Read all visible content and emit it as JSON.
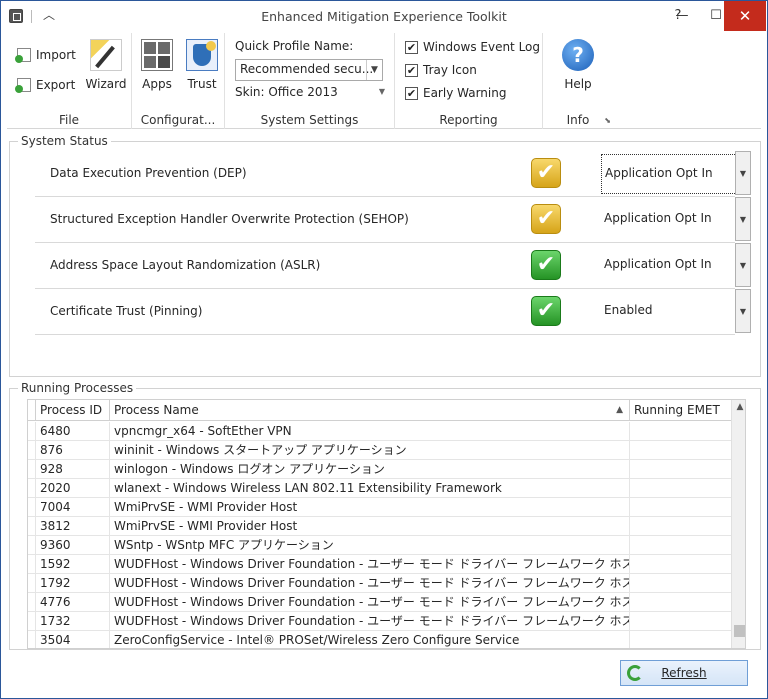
{
  "window": {
    "title": "Enhanced Mitigation Experience Toolkit"
  },
  "ribbon": {
    "file": {
      "label": "File",
      "import": "Import",
      "export": "Export",
      "wizard": "Wizard"
    },
    "configuration": {
      "label": "Configurat...",
      "apps": "Apps",
      "trust": "Trust"
    },
    "system_settings": {
      "label": "System Settings",
      "quick_profile_label": "Quick Profile Name:",
      "quick_profile_value": "Recommended secu...",
      "skin": "Skin: Office 2013"
    },
    "reporting": {
      "label": "Reporting",
      "windows_event_log": "Windows Event Log",
      "tray_icon": "Tray Icon",
      "early_warning": "Early Warning"
    },
    "info": {
      "label": "Info",
      "help": "Help"
    }
  },
  "system_status": {
    "title": "System Status",
    "rows": [
      {
        "label": "Data Execution Prevention (DEP)",
        "value": "Application Opt In",
        "status": "yellow"
      },
      {
        "label": "Structured Exception Handler Overwrite Protection (SEHOP)",
        "value": "Application Opt In",
        "status": "yellow"
      },
      {
        "label": "Address Space Layout Randomization (ASLR)",
        "value": "Application Opt In",
        "status": "green"
      },
      {
        "label": "Certificate Trust (Pinning)",
        "value": "Enabled",
        "status": "green"
      }
    ]
  },
  "running_processes": {
    "title": "Running Processes",
    "columns": [
      "Process ID",
      "Process Name",
      "Running EMET"
    ],
    "rows": [
      {
        "pid": "6480",
        "name": "vpncmgr_x64 - SoftEther VPN",
        "emet": ""
      },
      {
        "pid": "876",
        "name": "wininit - Windows スタートアップ アプリケーション",
        "emet": ""
      },
      {
        "pid": "928",
        "name": "winlogon - Windows ログオン アプリケーション",
        "emet": ""
      },
      {
        "pid": "2020",
        "name": "wlanext - Windows Wireless LAN 802.11 Extensibility Framework",
        "emet": ""
      },
      {
        "pid": "7004",
        "name": "WmiPrvSE - WMI Provider Host",
        "emet": ""
      },
      {
        "pid": "3812",
        "name": "WmiPrvSE - WMI Provider Host",
        "emet": ""
      },
      {
        "pid": "9360",
        "name": "WSntp - WSntp MFC アプリケーション",
        "emet": ""
      },
      {
        "pid": "1592",
        "name": "WUDFHost - Windows Driver Foundation - ユーザー モード ドライバー フレームワーク ホスト プロセス",
        "emet": ""
      },
      {
        "pid": "1792",
        "name": "WUDFHost - Windows Driver Foundation - ユーザー モード ドライバー フレームワーク ホスト プロセス",
        "emet": ""
      },
      {
        "pid": "4776",
        "name": "WUDFHost - Windows Driver Foundation - ユーザー モード ドライバー フレームワーク ホスト プロセス",
        "emet": ""
      },
      {
        "pid": "1732",
        "name": "WUDFHost - Windows Driver Foundation - ユーザー モード ドライバー フレームワーク ホスト プロセス",
        "emet": ""
      },
      {
        "pid": "3504",
        "name": "ZeroConfigService - Intel® PROSet/Wireless Zero Configure Service",
        "emet": ""
      }
    ],
    "refresh": "Refresh"
  },
  "icons": {
    "window_controls": [
      "help-icon",
      "minimize-icon",
      "maximize-icon",
      "close-icon"
    ],
    "status": {
      "yellow": "#e2b42a",
      "green": "#3bb33b"
    }
  }
}
